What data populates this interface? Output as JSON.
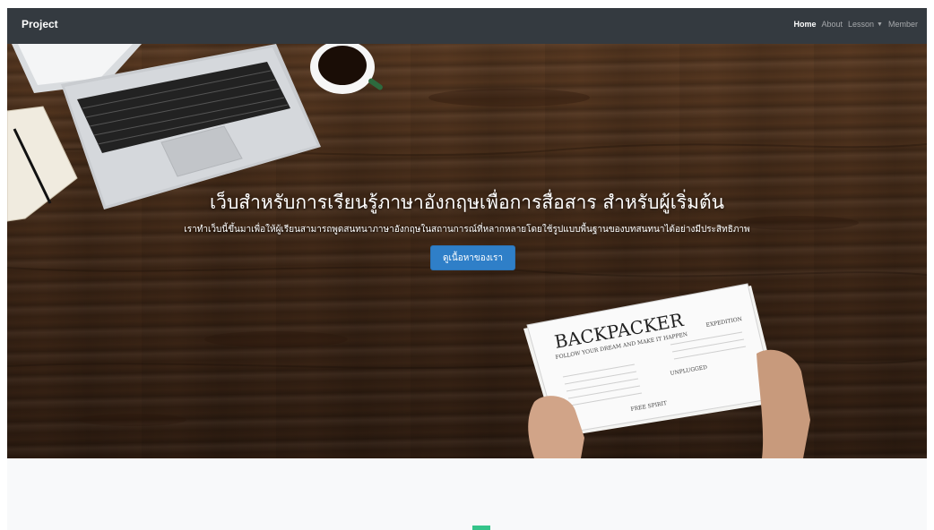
{
  "navbar": {
    "brand": "Project",
    "links": [
      {
        "label": "Home",
        "active": true
      },
      {
        "label": "About",
        "active": false
      },
      {
        "label": "Lesson",
        "active": false,
        "dropdown": true
      },
      {
        "label": "Member",
        "active": false
      }
    ]
  },
  "hero": {
    "title": "เว็บสำหรับการเรียนรู้ภาษาอังกฤษเพื่อการสื่อสาร สำหรับผู้เริ่มต้น",
    "subtitle": "เราทำเว็บนี้ขึ้นมาเพื่อให้ผู้เรียนสามารถพูดสนทนาภาษาอังกฤษในสถานการณ์ที่หลากหลายโดยใช้รูปแบบพื้นฐานของบทสนทนาได้อย่างมีประสิทธิภาพ",
    "button_label": "ดูเนื้อหาของเรา",
    "newspaper": {
      "masthead": "BACKPACKER",
      "tagline": "FOLLOW YOUR DREAM AND MAKE IT HAPPEN",
      "expedition": "EXPEDITION",
      "unplugged": "UNPLUGGED",
      "free_spirit": "FREE SPIRIT"
    }
  },
  "colors": {
    "navbar_bg": "#343a40",
    "button_bg": "#2f7fc8",
    "accent_green": "#34c48a",
    "page_bg": "#f8f9fa"
  },
  "icons": [
    "caret-down-icon",
    "laptop-image",
    "coffee-cup-image",
    "notebook-image",
    "newspaper-image",
    "hand-image"
  ]
}
